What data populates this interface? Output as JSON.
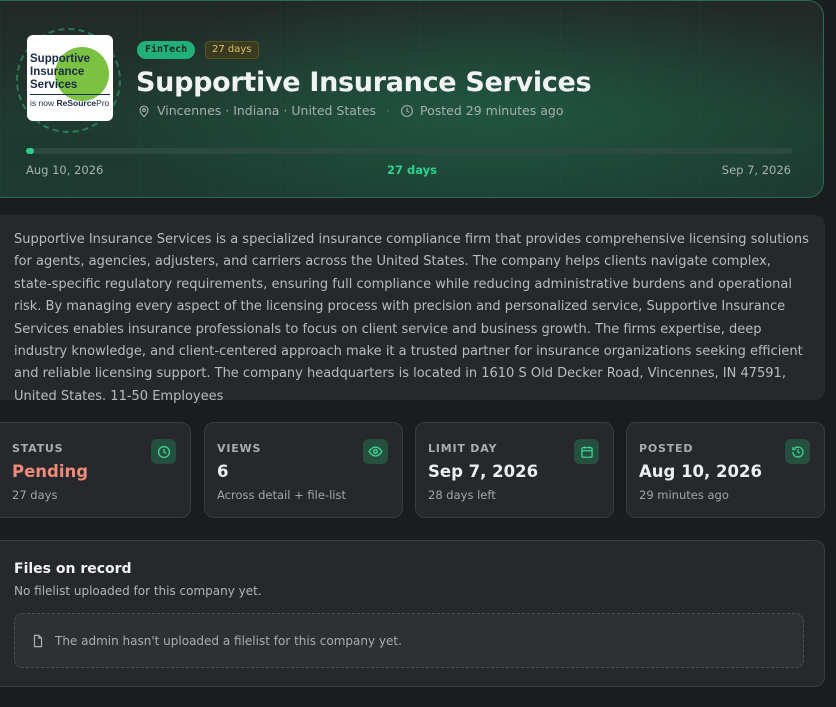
{
  "company": {
    "logo_text": {
      "line1": "Supportive",
      "line2": "Insurance",
      "line3": "Services",
      "tagline_prefix": "is now ",
      "tagline_brand": "ReSource",
      "tagline_suffix": "Pro"
    },
    "sector_tag": "FinTech",
    "days_tag": "27 days",
    "name": "Supportive Insurance Services",
    "location": "Vincennes · Indiana · United States",
    "posted": "Posted 29 minutes ago"
  },
  "timeline": {
    "start_date": "Aug 10, 2026",
    "end_date": "Sep 7, 2026",
    "middle_label": "27 days",
    "progress_fraction": 0.01
  },
  "description": "Supportive Insurance Services is a specialized insurance compliance firm that provides comprehensive licensing solutions for agents, agencies, adjusters, and carriers across the United States. The company helps clients navigate complex, state-specific regulatory requirements, ensuring full compliance while reducing administrative burdens and operational risk. By managing every aspect of the licensing process with precision and personalized service, Supportive Insurance Services enables insurance professionals to focus on client service and business growth. The firms expertise, deep industry knowledge, and client-centered approach make it a trusted partner for insurance organizations seeking efficient and reliable licensing support. The company headquarters is located in 1610 S Old Decker Road, Vincennes, IN 47591, United States. 11-50 Employees",
  "stats": {
    "status": {
      "label": "STATUS",
      "value": "Pending",
      "sub": "27 days",
      "icon": "clock-icon"
    },
    "views": {
      "label": "VIEWS",
      "value": "6",
      "sub": "Across detail + file-list",
      "icon": "eye-icon"
    },
    "limit": {
      "label": "LIMIT DAY",
      "value": "Sep 7, 2026",
      "sub": "28 days left",
      "icon": "calendar-icon"
    },
    "posted": {
      "label": "POSTED",
      "value": "Aug 10, 2026",
      "sub": "29 minutes ago",
      "icon": "history-icon"
    }
  },
  "files": {
    "title": "Files on record",
    "subtitle": "No filelist uploaded for this company yet.",
    "empty_message": "The admin hasn't uploaded a filelist for this company yet."
  },
  "colors": {
    "accent": "#2ad08c",
    "status_pending": "#f08a7a",
    "days_tag": "#d8c26a"
  }
}
